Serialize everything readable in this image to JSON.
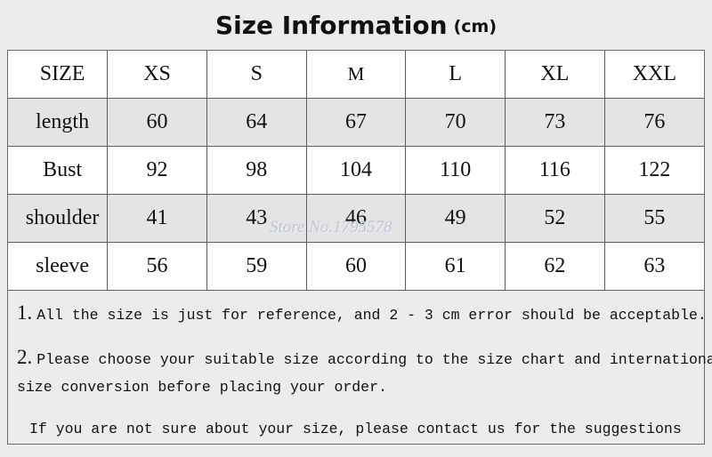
{
  "title": {
    "main": "Size Information",
    "unit": "(cm)"
  },
  "table": {
    "headers": [
      "SIZE",
      "XS",
      "S",
      "M",
      "L",
      "XL",
      "XXL"
    ],
    "rows": [
      {
        "label": "length",
        "values": [
          "60",
          "64",
          "67",
          "70",
          "73",
          "76"
        ]
      },
      {
        "label": "Bust",
        "values": [
          "92",
          "98",
          "104",
          "110",
          "116",
          "122"
        ]
      },
      {
        "label": "shoulder",
        "values": [
          "41",
          "43",
          "46",
          "49",
          "52",
          "55"
        ]
      },
      {
        "label": "sleeve",
        "values": [
          "56",
          "59",
          "60",
          "61",
          "62",
          "63"
        ]
      }
    ]
  },
  "notes": [
    {
      "number": "1.",
      "text": "All the size is just for reference, and 2 - 3 cm error should be acceptable."
    },
    {
      "number": "2.",
      "text": "Please choose your suitable size according to the size chart and international"
    },
    {
      "number": "",
      "text": "size conversion before placing your order."
    },
    {
      "number": "",
      "text": "If you are not sure about your size, please contact us for the suggestions"
    }
  ],
  "watermark": "Store No.1795578",
  "colors": {
    "page_background": "#ececec",
    "cell_shaded": "#e4e4e4",
    "cell_plain": "#ffffff",
    "border": "#5c5c5c",
    "text": "#111111",
    "watermark": "#b9bfcc"
  }
}
